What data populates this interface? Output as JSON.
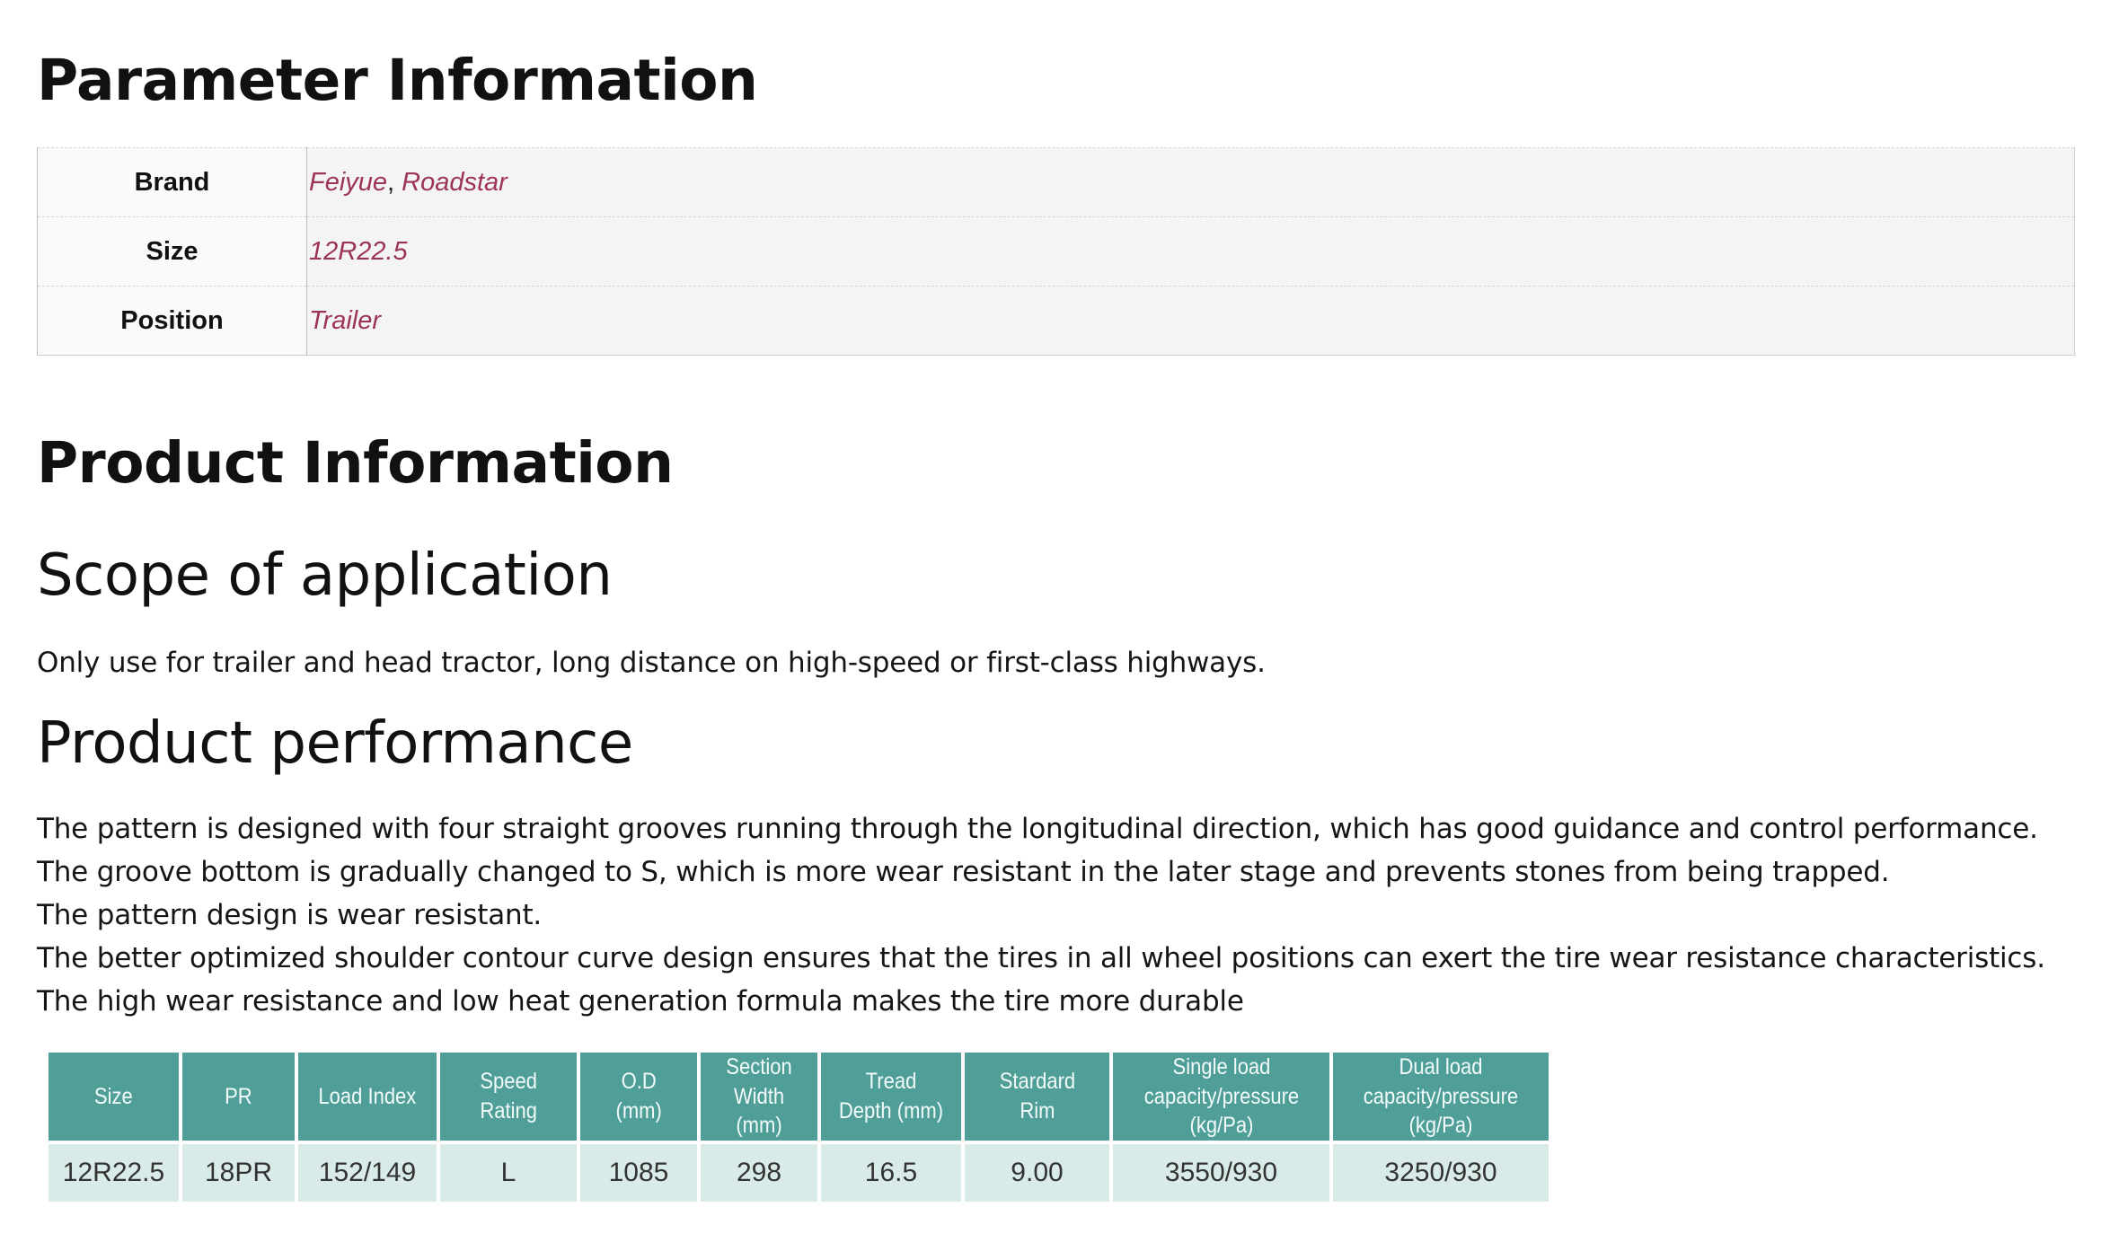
{
  "sections": {
    "parameter_title": "Parameter Information",
    "product_title": "Product Information",
    "scope_title": "Scope of application",
    "performance_title": "Product performance"
  },
  "parameters": {
    "brand_label": "Brand",
    "brand_values": [
      "Feiyue",
      "Roadstar"
    ],
    "brand_separator": ",",
    "size_label": "Size",
    "size_value": "12R22.5",
    "position_label": "Position",
    "position_value": "Trailer"
  },
  "scope_text": "Only use for trailer and head tractor, long distance on high-speed or first-class highways.",
  "performance_lines": [
    "The pattern is designed with four straight grooves running through the longitudinal direction, which has good guidance and control performance.",
    "The groove bottom is gradually changed to S, which is more wear resistant in the later stage and prevents stones from being trapped.",
    "The pattern design is wear resistant.",
    "The better optimized shoulder contour curve design ensures that the tires in all wheel positions can exert the tire wear resistance characteristics.",
    "The high wear resistance and low heat generation formula makes the tire more durable"
  ],
  "spec_table": {
    "headers": [
      "Size",
      "PR",
      "Load Index",
      "Speed\nRating",
      "O.D\n(mm)",
      "Section\nWidth (mm)",
      "Tread\nDepth (mm)",
      "Stardard\nRim",
      "Single load\ncapacity/pressure\n(kg/Pa)",
      "Dual load\ncapacity/pressure\n(kg/Pa)"
    ],
    "row": [
      "12R22.5",
      "18PR",
      "152/149",
      "L",
      "1085",
      "298",
      "16.5",
      "9.00",
      "3550/930",
      "3250/930"
    ]
  },
  "colors": {
    "header_bg": "#4f9f98",
    "row_bg": "#d8ebe8",
    "link_text": "#9c3358"
  }
}
